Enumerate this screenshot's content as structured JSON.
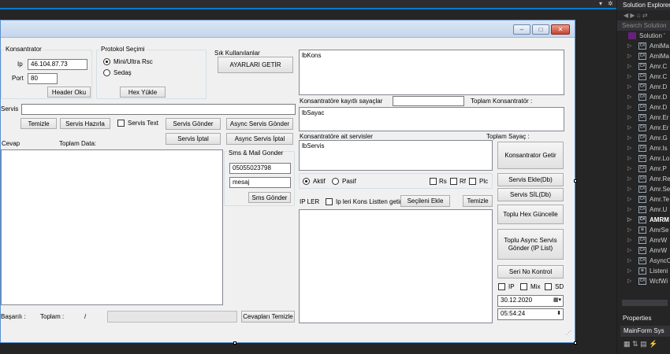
{
  "window": {
    "minimize": "–",
    "maximize": "□",
    "close": "✕"
  },
  "konsantrator": {
    "group_title": "Konsantrator",
    "ip_label": "Ip",
    "ip_value": "46.104.87.73",
    "port_label": "Port",
    "port_value": "80",
    "header_button": "Header Oku"
  },
  "protokol": {
    "group_title": "Protokol Seçimi",
    "options": [
      "Mini/Ultra Rsc",
      "Sedaş"
    ],
    "selected": "Mini/Ultra Rsc",
    "hex_button": "Hex Yükle"
  },
  "sik": {
    "group_title": "Sık Kullanılanlar",
    "ayarlar_button": "AYARLARI GETİR"
  },
  "servis": {
    "label": "Servis",
    "value": "",
    "temizle": "Temizle",
    "hazirla": "Servis Hazırla",
    "text_checkbox": "Servis Text",
    "gonder": "Servis Gönder",
    "async_gonder": "Async Servis Gönder",
    "iptal": "Servis İptal",
    "async_iptal": "Async Servis İptal"
  },
  "cevap": {
    "label": "Cevap",
    "toplam_data": "Toplam Data:"
  },
  "sms": {
    "group_title": "Sms & Mail Gonder",
    "phone": "05055023798",
    "message": "mesaj",
    "send_button": "Sms Gönder"
  },
  "footer": {
    "basarili": "Başarılı :",
    "toplam": "Toplam :",
    "slash": "/",
    "temizle_button": "Cevapları Temizle"
  },
  "right": {
    "lbkons": "lbKons",
    "kayitli_label": "Konsantratöre kayıtlı sayaçlar",
    "toplam_kons": "Toplam Konsantratör :",
    "lbsayac": "lbSayac",
    "ait_servis_label": "Konsantratöre ait servisler",
    "toplam_sayac": "Toplam Sayaç :",
    "lbservis": "lbServis",
    "aktif": "Aktif",
    "pasif": "Pasif",
    "aktif_selected": true,
    "chk_rs": "Rs",
    "chk_rf": "Rf",
    "chk_plc": "Plc",
    "ipler": "IP LER",
    "ipler_checkbox": "Ip leri Kons Listten getir",
    "secileni_ekle": "Seçileni Ekle",
    "ip_temizle": "Temizle"
  },
  "side_buttons": {
    "kons_getir": "Konsantrator Getir",
    "servis_ekle": "Servis Ekle(Db)",
    "servis_sil": "Servis SİL(Db)",
    "toplu_hex": "Toplu Hex Güncelle",
    "toplu_async": "Toplu Async Servis Gönder (IP List)",
    "seri_no": "Seri No Kontrol",
    "chk_ip": "IP",
    "chk_mix": "Mix",
    "chk_sd": "SD",
    "date": "30.12.2020",
    "time": "05:54:24"
  },
  "solution_explorer": {
    "title": "Solution Explorer",
    "search": "Search Solution",
    "solution": "Solution '",
    "items": [
      "AmiMa",
      "AmiMa",
      "Amr.C",
      "Amr.C",
      "Amr.D",
      "Amr.D",
      "Amr.D",
      "Amr.Er",
      "Amr.Er",
      "Amr.G",
      "Amr.Is",
      "Amr.Lo",
      "Amr.P",
      "Amr.Re",
      "Amr.Se",
      "Amr.Te",
      "Amr.U",
      "AMRM",
      "AmrSe",
      "AmrW",
      "AmrW",
      "AsyncC",
      "Listeni",
      "WcfWi"
    ],
    "properties_title": "Properties",
    "properties_object": "MainForm Sys"
  }
}
